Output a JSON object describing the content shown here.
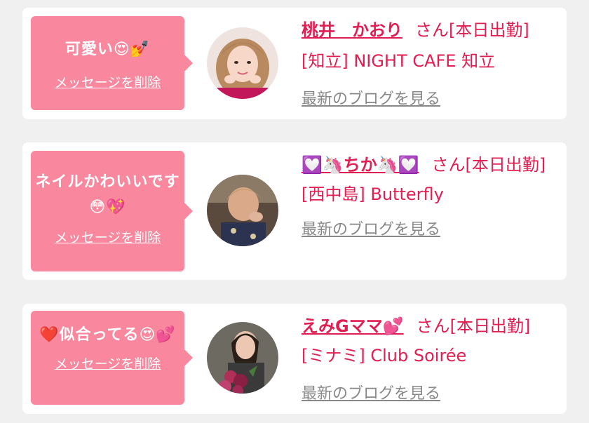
{
  "cards": [
    {
      "message": "可愛い😍💅",
      "delete_label": "メッセージを削除",
      "name": "桃井　かおり",
      "suffix": "さん[本日出勤]",
      "shop": "[知立] NIGHT CAFE 知立",
      "blog_label": "最新のブログを見る",
      "avatar_icon": "avatar-photo"
    },
    {
      "message": "ネイルかわいいです😳💖",
      "delete_label": "メッセージを削除",
      "name": "💟🦄ちか🦄💟",
      "suffix": "さん[本日出勤]",
      "shop": "[西中島] Butterfly",
      "blog_label": "最新のブログを見る",
      "avatar_icon": "avatar-photo"
    },
    {
      "message": "❤️似合ってる😍💕",
      "delete_label": "メッセージを削除",
      "name": "えみGママ💕",
      "suffix": "さん[本日出勤]",
      "shop": "[ミナミ] Club Soirée",
      "blog_label": "最新のブログを見る",
      "avatar_icon": "avatar-photo"
    }
  ],
  "colors": {
    "bubble": "#f9879d",
    "accent": "#e01e52",
    "link_gray": "#888888",
    "background": "#f0f0f0"
  }
}
